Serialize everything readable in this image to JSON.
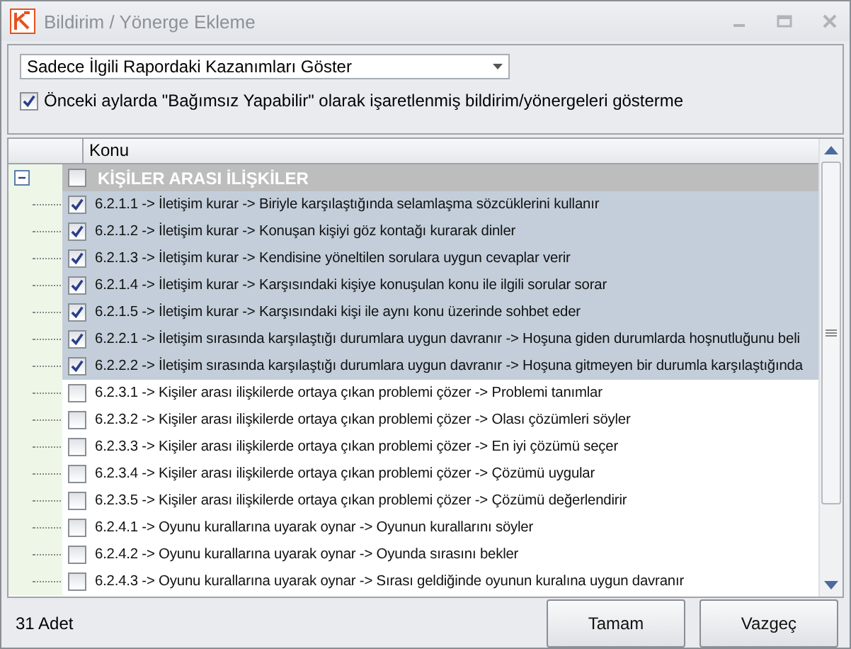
{
  "window": {
    "title": "Bildirim / Yönerge Ekleme"
  },
  "filter": {
    "value": "Sadece İlgili Rapordaki Kazanımları Göster"
  },
  "hide_option": {
    "label": "Önceki aylarda \"Bağımsız Yapabilir\" olarak işaretlenmiş bildirim/yönergeleri gösterme",
    "checked": true
  },
  "table": {
    "columns": [
      "Konu"
    ],
    "groups": [
      {
        "label": "KİŞİLER ARASI İLİŞKİLER",
        "checked": false,
        "expanded": true,
        "children": [
          {
            "label": "6.2.1.1 -> İletişim kurar -> Biriyle karşılaştığında selamlaşma sözcüklerini kullanır",
            "checked": true
          },
          {
            "label": "6.2.1.2 -> İletişim kurar -> Konuşan kişiyi göz kontağı kurarak dinler",
            "checked": true
          },
          {
            "label": "6.2.1.3 -> İletişim kurar -> Kendisine yöneltilen sorulara uygun cevaplar verir",
            "checked": true
          },
          {
            "label": "6.2.1.4 -> İletişim kurar -> Karşısındaki kişiye konuşulan konu ile ilgili sorular sorar",
            "checked": true
          },
          {
            "label": "6.2.1.5 -> İletişim kurar -> Karşısındaki kişi ile aynı konu üzerinde sohbet eder",
            "checked": true
          },
          {
            "label": "6.2.2.1 -> İletişim sırasında karşılaştığı durumlara uygun davranır -> Hoşuna giden durumlarda hoşnutluğunu beli",
            "checked": true
          },
          {
            "label": "6.2.2.2 -> İletişim sırasında karşılaştığı durumlara uygun davranır -> Hoşuna gitmeyen bir durumla karşılaştığında",
            "checked": true
          },
          {
            "label": "6.2.3.1 -> Kişiler arası ilişkilerde ortaya çıkan problemi çözer -> Problemi tanımlar",
            "checked": false
          },
          {
            "label": "6.2.3.2 -> Kişiler arası ilişkilerde ortaya çıkan problemi çözer -> Olası çözümleri söyler",
            "checked": false
          },
          {
            "label": "6.2.3.3 -> Kişiler arası ilişkilerde ortaya çıkan problemi çözer -> En iyi çözümü seçer",
            "checked": false
          },
          {
            "label": "6.2.3.4 -> Kişiler arası ilişkilerde ortaya çıkan problemi çözer -> Çözümü uygular",
            "checked": false
          },
          {
            "label": "6.2.3.5 -> Kişiler arası ilişkilerde ortaya çıkan problemi çözer -> Çözümü değerlendirir",
            "checked": false
          },
          {
            "label": "6.2.4.1 -> Oyunu kurallarına uyarak oynar -> Oyunun kurallarını söyler",
            "checked": false
          },
          {
            "label": "6.2.4.2 -> Oyunu kurallarına uyarak oynar -> Oyunda sırasını bekler",
            "checked": false
          },
          {
            "label": "6.2.4.3 -> Oyunu kurallarına uyarak oynar -> Sırası geldiğinde oyunun kuralına uygun davranır",
            "checked": false
          }
        ]
      }
    ]
  },
  "status": "31 Adet",
  "buttons": [
    "Tamam",
    "Vazgeç"
  ]
}
